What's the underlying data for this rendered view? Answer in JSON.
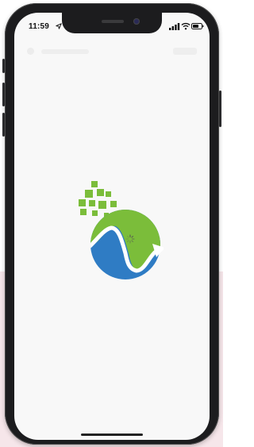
{
  "status_bar": {
    "time": "11:59",
    "location_icon": "location-arrow-icon",
    "signal_icon": "cellular-signal-icon",
    "wifi_icon": "wifi-icon",
    "battery_icon": "battery-icon"
  },
  "splash": {
    "logo_icon": "globe-data-logo-icon",
    "loading_icon": "loading-spinner-icon"
  },
  "colors": {
    "logo_green": "#7bbd3a",
    "logo_blue": "#2f7cc4",
    "screen_background": "#f8f8f8",
    "frame": "#1c1c1e",
    "backdrop_pink": "#f6e6ea"
  }
}
